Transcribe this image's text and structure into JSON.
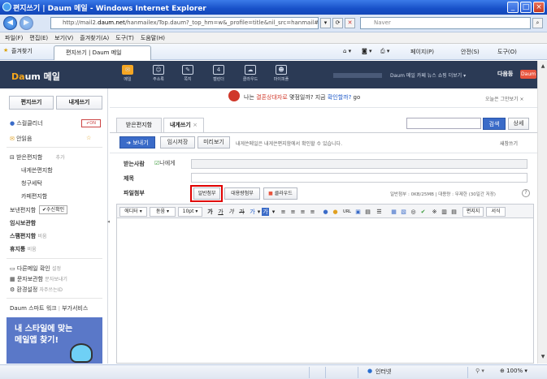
{
  "window": {
    "title": "편지쓰기 | Daum 메일 - Windows Internet Explorer",
    "min": "_",
    "max": "□",
    "close": "×"
  },
  "address": {
    "url_prefix": "http://mail2.",
    "url_domain": "daum.net",
    "url_rest": "/hanmailex/Top.daum?_top_hm=w&_profile=title&nil_src=hanmail#Compos",
    "back": "◀",
    "forward": "▶",
    "search_placeholder": "Naver"
  },
  "menubar": [
    "파일(F)",
    "편집(E)",
    "보기(V)",
    "즐겨찾기(A)",
    "도구(T)",
    "도움말(H)"
  ],
  "favbar": {
    "favorites": "즐겨찾기",
    "tab": "편지쓰기 | Daum 메일",
    "page": "페이지(P)",
    "safety": "안전(S)",
    "tools": "도구(O)"
  },
  "daum": {
    "logo_d": "Da",
    "logo_rest": "um 메일",
    "nav": [
      {
        "label": "메일",
        "icon": "mail"
      },
      {
        "label": "주소록",
        "icon": "contacts"
      },
      {
        "label": "쪽지",
        "icon": "note"
      },
      {
        "label": "캘린더",
        "icon": "calendar"
      },
      {
        "label": "클라우드",
        "icon": "cloud"
      },
      {
        "label": "마이피플",
        "icon": "mypeople"
      }
    ],
    "links": "Daum 메일 카페 뉴스 쇼핑 더보기 ▾",
    "user": "다음둥",
    "badge": "Daum"
  },
  "sidebar": {
    "compose": "편지쓰기",
    "to_me": "내게쓰기",
    "spam_cleaner": "스컬클리너",
    "on_badge": "✔ON",
    "unread": "안읽음",
    "star": "☆",
    "inbox": "받은편지함",
    "add": "추가",
    "my_inbox": "내게쓴편지함",
    "purchases": "청구세탁",
    "cafe": "카페편지함",
    "sent": "보낸편지함",
    "confirm_badge": "✔수신확인",
    "temp": "임시보관함",
    "spam": "스팸편지함",
    "spam_extra": "비움",
    "trash": "휴지통",
    "trash_extra": "비움",
    "other_mail": "다른메일 확인",
    "other_mail_extra": "설정",
    "sms": "문자보관함",
    "sms_extra": "문자보내기",
    "settings": "환경설정",
    "settings_extra": "자주쓰는ID",
    "work": "Daum 스마트 워크",
    "extra_service": "부가서비스",
    "ad_line1": "내 스타일에 맞는",
    "ad_line2": "메일앱 찾기!"
  },
  "main": {
    "promo_pre": "나는",
    "promo_red": "결혼상대자로",
    "promo_mid": "몇점일까? 지금",
    "promo_blue": "확인할까?",
    "promo_go": "go",
    "hide": "오늘은 그만보기 ×",
    "tab_inbox": "받은편지함",
    "tab_compose": "내게쓰기",
    "tab_close": "×",
    "search_btn": "검색",
    "detail_btn": "상세",
    "send": "➜ 보내기",
    "temp_save": "임시저장",
    "preview": "미리보기",
    "notice": "내게쓴메일은 내게쓴편지함에서 확인할 수 있습니다.",
    "new_window": "새창쓰기",
    "recipient_label": "받는사람",
    "recipient_check": "나에게",
    "subject_label": "제목",
    "attach_label": "파일첨부",
    "attach_normal": "일반첨부",
    "attach_bulk": "대용량첨부",
    "attach_cloud": "클라우드",
    "attach_info": "일반첨부 : 0KB/25MB | 대용량 : 무제한 (30일간 저장)",
    "help_icon": "?"
  },
  "editor_toolbar": {
    "editor": "에디터",
    "font": "돋움",
    "size": "10pt",
    "bold": "가",
    "underline": "가",
    "italic": "가",
    "strike": "가",
    "color": "가",
    "bgcolor": "가",
    "url": "URL",
    "letter": "편지지",
    "sign": "서식"
  },
  "status": {
    "zone": "인터넷",
    "zoom": "100%"
  }
}
